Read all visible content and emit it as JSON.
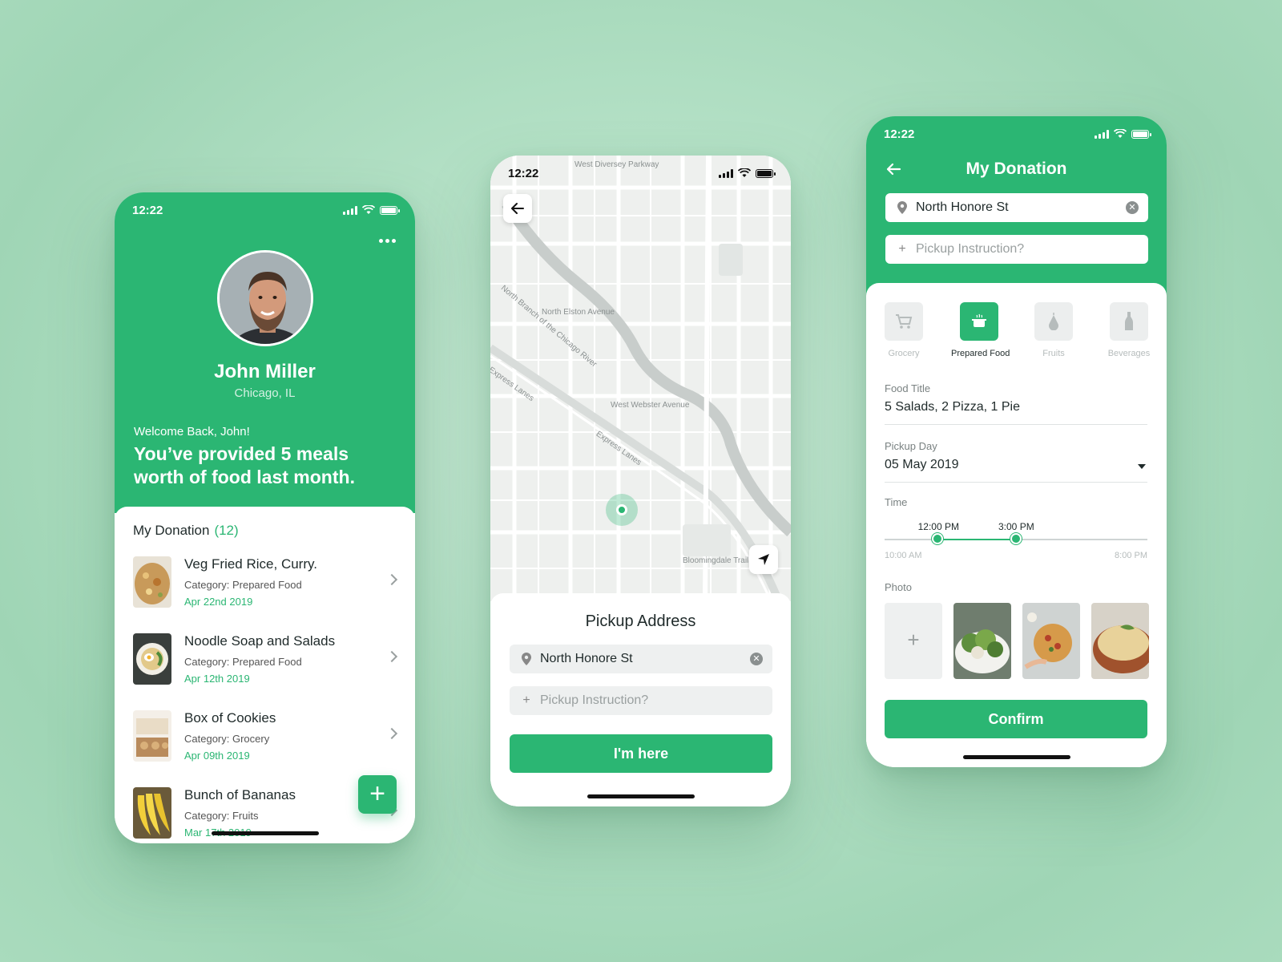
{
  "status": {
    "time": "12:22"
  },
  "profile": {
    "name": "John Miller",
    "city": "Chicago, IL",
    "welcome": "Welcome Back, John!",
    "headline": "You’ve provided 5 meals worth of food last month.",
    "section_title": "My Donation",
    "section_count": "(12)",
    "donations": [
      {
        "title": "Veg Fried Rice, Curry.",
        "category": "Category: Prepared Food",
        "date": "Apr 22nd 2019"
      },
      {
        "title": "Noodle Soap and Salads",
        "category": "Category: Prepared Food",
        "date": "Apr 12th 2019"
      },
      {
        "title": "Box of Cookies",
        "category": "Category: Grocery",
        "date": "Apr 09th  2019"
      },
      {
        "title": "Bunch of Bananas",
        "category": "Category: Fruits",
        "date": "Mar 17th 2019"
      }
    ],
    "fab_label": "+"
  },
  "pickup": {
    "map_labels": {
      "street_top": "West Diversey Parkway",
      "river": "North Branch of the Chicago River",
      "elston": "North Elston Avenue",
      "webster": "West Webster Avenue",
      "express": "Express Lanes",
      "express2": "Express Lanes",
      "bloomingdale": "Bloomingdale Trail"
    },
    "title": "Pickup Address",
    "address": "North Honore St",
    "instruction_placeholder": "Pickup Instruction?",
    "button": "I'm here"
  },
  "donation_form": {
    "title": "My Donation",
    "address": "North Honore St",
    "instruction_placeholder": "Pickup Instruction?",
    "categories": [
      {
        "label": "Grocery",
        "icon": "cart-icon",
        "active": false
      },
      {
        "label": "Prepared Food",
        "icon": "pot-icon",
        "active": true
      },
      {
        "label": "Fruits",
        "icon": "pear-icon",
        "active": false
      },
      {
        "label": "Beverages",
        "icon": "bottle-icon",
        "active": false
      }
    ],
    "food_title_label": "Food Title",
    "food_title_value": "5 Salads, 2 Pizza, 1 Pie",
    "pickup_day_label": "Pickup Day",
    "pickup_day_value": "05 May 2019",
    "time_label": "Time",
    "time_start": "12:00 PM",
    "time_end": "3:00 PM",
    "time_min": "10:00 AM",
    "time_max": "8:00 PM",
    "time_range_fraction": [
      0.2,
      0.5
    ],
    "photo_label": "Photo",
    "add_photo": "+",
    "button": "Confirm"
  },
  "colors": {
    "accent": "#2bb673"
  }
}
